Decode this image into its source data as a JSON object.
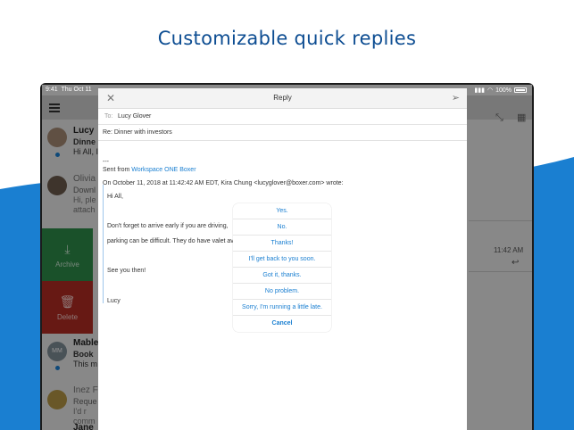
{
  "headline": "Customizable quick replies",
  "status": {
    "time": "9:41",
    "date": "Thu Oct 11",
    "battery": "100%"
  },
  "inbox": {
    "rows": [
      {
        "sender": "Lucy",
        "subject": "Dinne",
        "preview": "Hi All, I",
        "unread": true
      },
      {
        "sender": "Olivia",
        "subject": "Downl",
        "preview": "Hi, ple",
        "preview2": "attach"
      },
      {
        "sender": "Mable",
        "initials": "MM",
        "subject": "Book",
        "preview": "This m",
        "unread": true
      },
      {
        "sender": "Inez F",
        "subject": "Reque",
        "preview": "I'd r",
        "preview2": "comm"
      },
      {
        "sender": "Jane"
      }
    ],
    "archive_label": "Archive",
    "delete_label": "Delete",
    "right_time": "11:42 AM"
  },
  "compose": {
    "title": "Reply",
    "to_label": "To:",
    "to_value": "Lucy Glover",
    "subject": "Re: Dinner with investors",
    "separator": "---",
    "sent_from_prefix": "Sent from ",
    "sent_from_link": "Workspace ONE Boxer",
    "attribution": "On October 11, 2018 at 11:42:42 AM EDT, Kira Chung <lucyglover@boxer.com> wrote:",
    "quote": {
      "greeting": "Hi All,",
      "line1": "Don't forget to arrive early if you are driving,",
      "line2": "parking can be difficult. They do have valet ava",
      "line3": "See you then!",
      "signature": "Lucy"
    }
  },
  "quick_replies": {
    "options": [
      "Yes.",
      "No.",
      "Thanks!",
      "I'll get back to you soon.",
      "Got it, thanks.",
      "No problem.",
      "Sorry, I'm running a little late."
    ],
    "cancel": "Cancel"
  },
  "colors": {
    "headline": "#0d4d92",
    "wave": "#1a7fd1",
    "link": "#1a7fd1",
    "archive": "#2e8c49",
    "delete": "#b22b24"
  }
}
